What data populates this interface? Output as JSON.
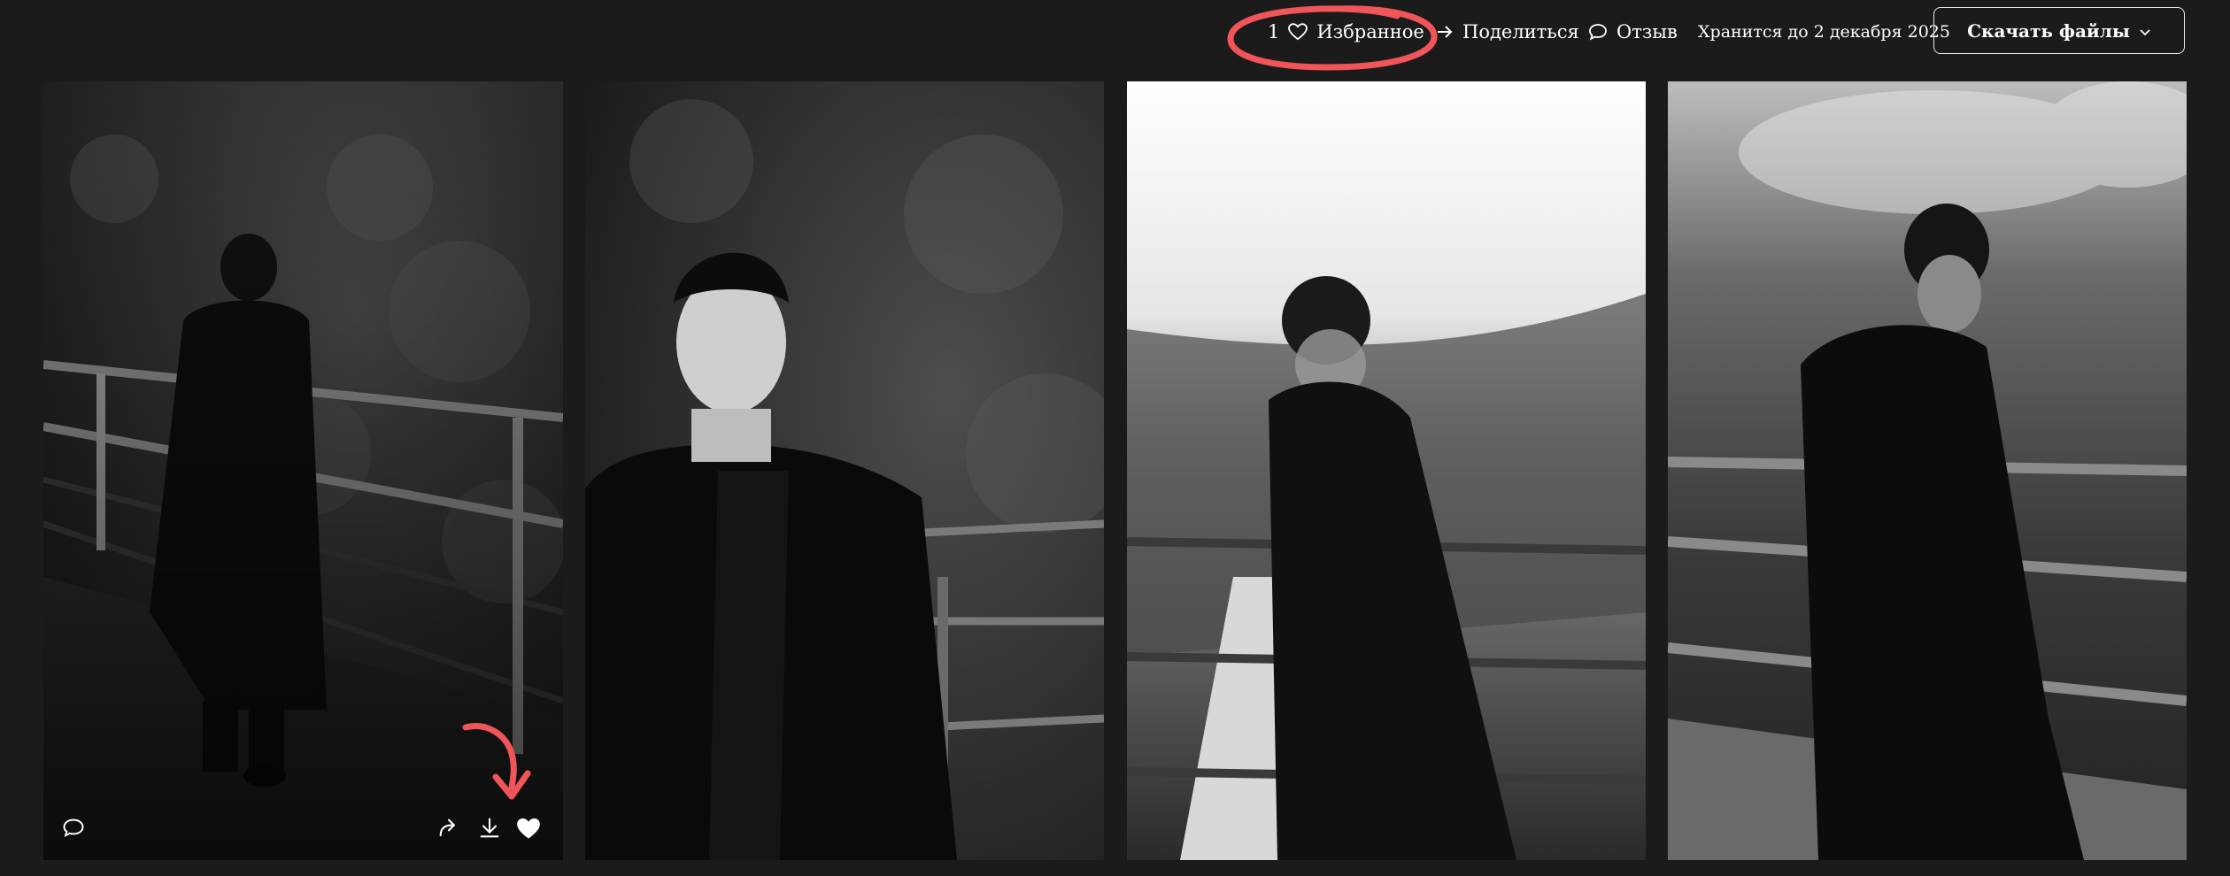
{
  "header": {
    "favorites_count": "1",
    "favorites_label": "Избранное",
    "share_label": "Поделиться",
    "review_label": "Отзыв",
    "stored_until": "Хранится до 2 декабря 2025",
    "download_label": "Скачать файлы"
  },
  "icons": {
    "favorites": "heart-outline-icon",
    "share": "arrow-right-icon",
    "review": "speech-bubble-icon",
    "dropdown": "chevron-down-icon",
    "card_comment": "speech-bubble-icon",
    "card_share": "share-curved-arrow-icon",
    "card_download": "download-icon",
    "card_like": "heart-filled-icon"
  },
  "colors": {
    "background": "#1b1b1b",
    "text": "#ffffff",
    "annotation": "#f0555a"
  },
  "gallery": {
    "photos": [
      {
        "tone": "dark-monochrome",
        "liked": true
      },
      {
        "tone": "dark-monochrome",
        "liked": false
      },
      {
        "tone": "light-monochrome-motion-blur",
        "liked": false
      },
      {
        "tone": "mid-monochrome-motion-blur",
        "liked": false
      }
    ]
  }
}
